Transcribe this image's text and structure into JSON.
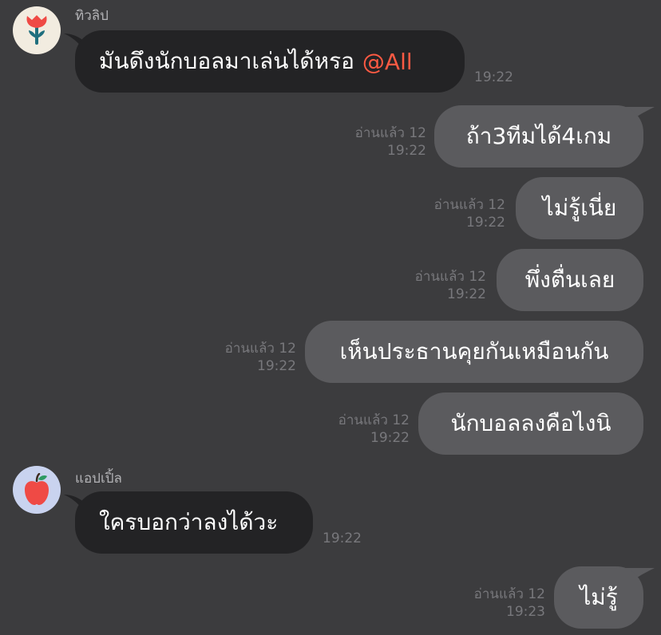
{
  "messages": [
    {
      "type": "incoming",
      "sender": "ทิวลิป",
      "avatar": "tulip-icon",
      "text": "มันดึงนักบอลมาเล่นได้หรอ",
      "mention": "@All",
      "time": "19:22"
    },
    {
      "type": "outgoing",
      "text": "ถ้า3ทีมได้4เกม",
      "read": "อ่านแล้ว 12",
      "time": "19:22"
    },
    {
      "type": "outgoing",
      "text": "ไม่รู้เนี่ย",
      "read": "อ่านแล้ว 12",
      "time": "19:22"
    },
    {
      "type": "outgoing",
      "text": "พึ่งตื่นเลย",
      "read": "อ่านแล้ว 12",
      "time": "19:22"
    },
    {
      "type": "outgoing",
      "text": "เห็นประธานคุยกันเหมือนกัน",
      "read": "อ่านแล้ว 12",
      "time": "19:22"
    },
    {
      "type": "outgoing",
      "text": "นักบอลลงคือไงนิ",
      "read": "อ่านแล้ว 12",
      "time": "19:22"
    },
    {
      "type": "incoming",
      "sender": "แอปเปิ้ล",
      "avatar": "apple-icon",
      "text": "ใครบอกว่าลงได้วะ",
      "time": "19:22"
    },
    {
      "type": "outgoing",
      "text": "ไม่รู้",
      "read": "อ่านแล้ว 12",
      "time": "19:23"
    }
  ],
  "colors": {
    "background": "#3c3c3e",
    "incoming_bubble": "#232325",
    "outgoing_bubble": "#5b5b5e",
    "mention": "#ff5a43",
    "meta_text": "#78787c"
  }
}
